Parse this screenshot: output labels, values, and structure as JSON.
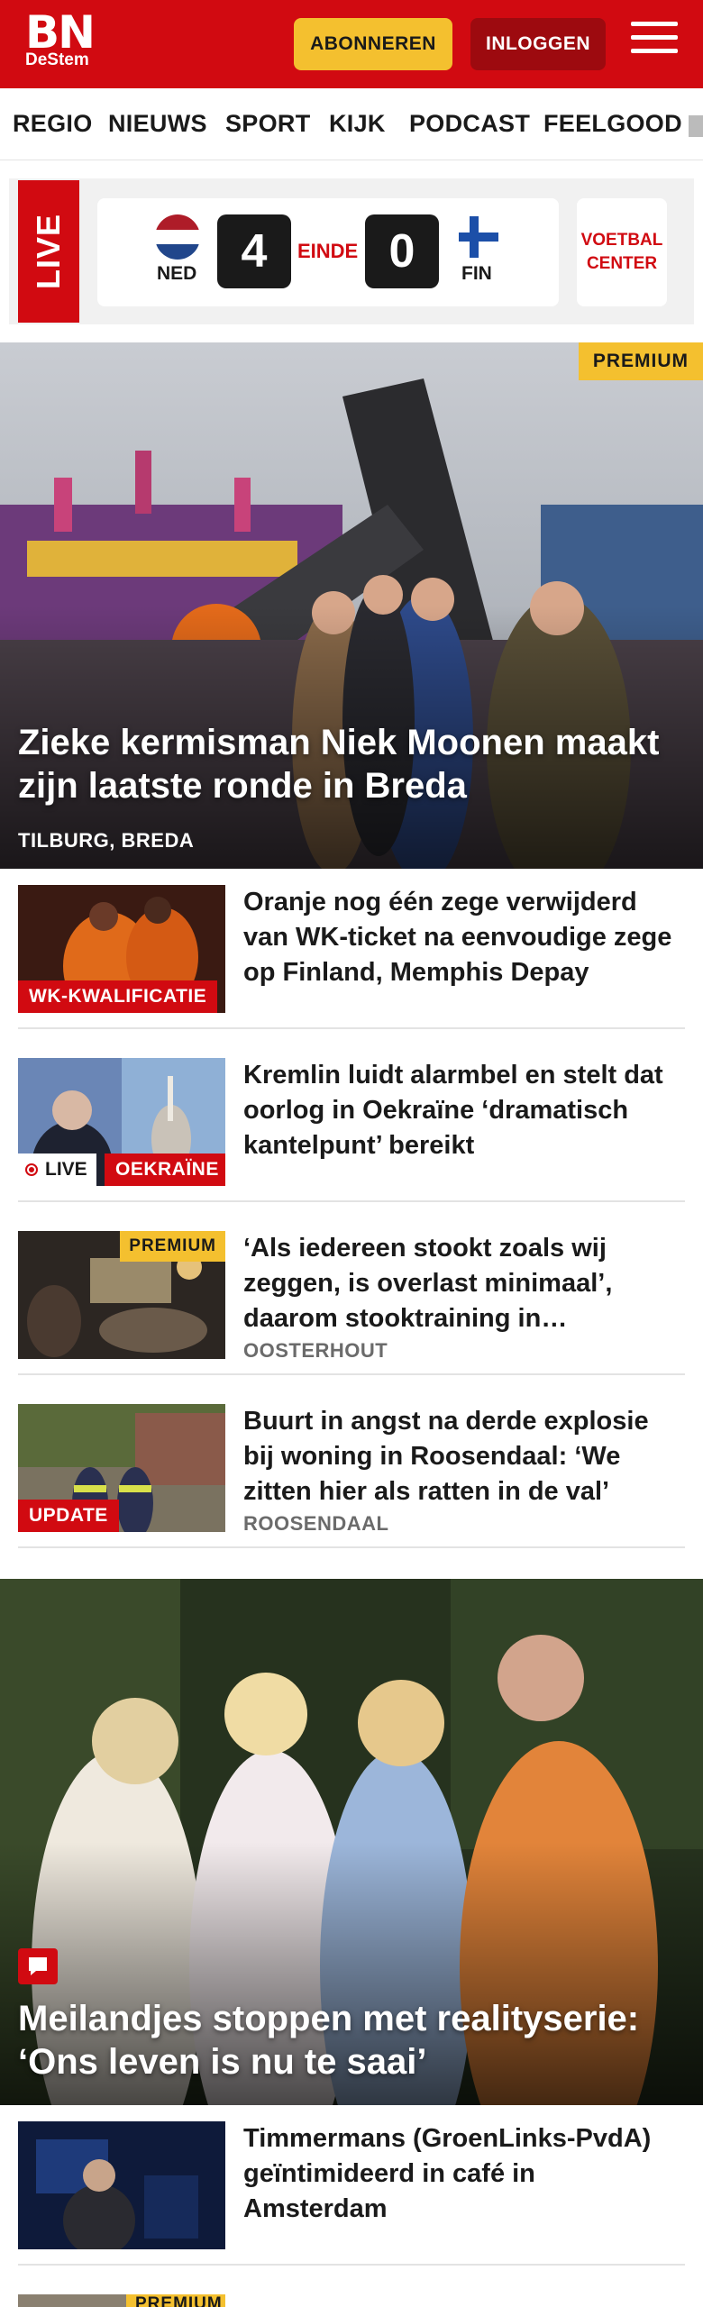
{
  "header": {
    "logo_main": "BN",
    "logo_sub": "DeStem",
    "subscribe_label": "ABONNEREN",
    "login_label": "INLOGGEN",
    "menu_icon": "hamburger-menu-icon",
    "brand_color": "#d10a11",
    "accent_color": "#f4c02f"
  },
  "nav": {
    "items": [
      "REGIO",
      "NIEUWS",
      "SPORT",
      "KIJK",
      "PODCAST",
      "FEELGOOD"
    ]
  },
  "live_score": {
    "live_label": "LIVE",
    "home_team": "NED",
    "home_score": "4",
    "status": "EINDE",
    "away_score": "0",
    "away_team": "FIN",
    "center_label_1": "VOETBAL",
    "center_label_2": "CENTER"
  },
  "hero": {
    "badge": "PREMIUM",
    "title": "Zieke kermisman Niek Moonen maakt zijn laatste ronde in Breda",
    "location": "TILBURG, BREDA"
  },
  "articles": [
    {
      "title": "Oranje nog één zege verwijderd van WK-ticket na eenvoudige zege op Finland, Memphis Depay",
      "label": "WK-KWALIFICATIE",
      "location": ""
    },
    {
      "title": "Kremlin luidt alarmbel en stelt dat oorlog in Oekraïne ‘dramatisch kantelpunt’ bereikt",
      "live_label": "LIVE",
      "label": "OEKRAÏNE",
      "location": ""
    },
    {
      "title": "‘Als iedereen stookt zoals wij zeggen, is overlast minimaal’, daarom stooktraining in…",
      "badge": "PREMIUM",
      "location": "OOSTERHOUT"
    },
    {
      "title": "Buurt in angst na derde explosie bij woning in Roosendaal: ‘We zitten hier als ratten in de val’",
      "label": "UPDATE",
      "location": "ROOSENDAAL"
    }
  ],
  "hero2": {
    "title": "Meilandjes stoppen met realityserie: ‘Ons leven is nu te saai’",
    "icon": "comment-icon"
  },
  "articles2": [
    {
      "title": "Timmermans (GroenLinks-PvdA) geïntimideerd in café in Amsterdam",
      "location": ""
    }
  ],
  "partial_item": {
    "badge": "PREMIUM"
  }
}
